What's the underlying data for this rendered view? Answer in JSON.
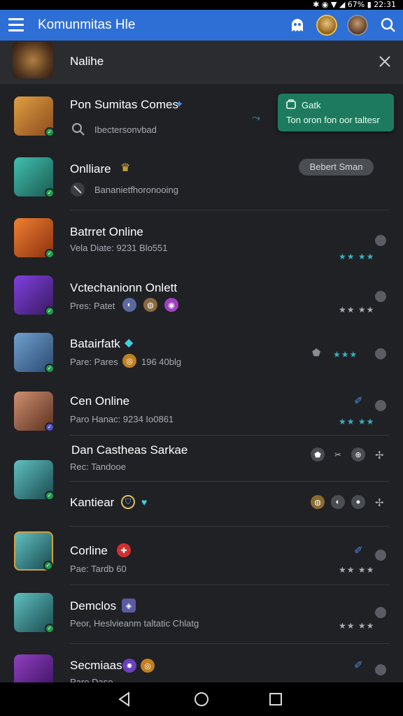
{
  "status": {
    "text": "✱ ◉ ▼ ◢ 67% ▮ 22:31"
  },
  "app": {
    "title": "Komunmitas Hle"
  },
  "icons": {
    "menu": "hamburger-menu-icon",
    "ghost": "ghost-icon",
    "search": "search-icon",
    "close": "close-icon",
    "back": "back-icon",
    "home": "home-icon",
    "recents": "recents-icon"
  },
  "banner": {
    "title": "Nalihe"
  },
  "toast": {
    "title": "Gatk",
    "text": "Ton oron fon oor taltesr"
  },
  "items": [
    {
      "name": "Pon Sumitas Comes",
      "sub": "Ibectersonvbad",
      "thumb": [
        "#e0a040",
        "#8a4a20"
      ]
    },
    {
      "name": "Onlliare",
      "sub": "Bananietfhoronooing",
      "pill": "Bebert Sman",
      "thumb": [
        "#40c0b0",
        "#1a5a50"
      ]
    },
    {
      "name": "Batrret Online",
      "sub": "Vela Diate: 9231 Blo551",
      "thumb": [
        "#f08030",
        "#8a3010"
      ]
    },
    {
      "name": "Vctechanionn Onlett",
      "sub": "Pres: Patet",
      "thumb": [
        "#8040e0",
        "#3a1a60"
      ]
    },
    {
      "name": "Batairfatk",
      "sub": "Pare: Pares",
      "sub_extra": "196 40blg",
      "thumb": [
        "#70a0d0",
        "#2a4a70"
      ]
    },
    {
      "name": "Cen Online",
      "sub": "Paro Hanac: 9234 Io0861",
      "thumb": [
        "#d09070",
        "#5a3020"
      ]
    },
    {
      "name": "Dan Castheas Sarkae",
      "sub": "Rec: Tandooe",
      "thumb": [
        "#60c0c0",
        "#1a4a50"
      ]
    },
    {
      "name": "Kantiear",
      "sub": "",
      "thumb": [
        "#60c0c0",
        "#1a4a50"
      ]
    },
    {
      "name": "Corline",
      "sub": "Pae: Tardb 60",
      "thumb": [
        "#9040c0",
        "#3a1060"
      ]
    },
    {
      "name": "Demclos",
      "sub": "Peor, Heslvieanm taltatic Chlatg",
      "thumb": [
        "#50b070",
        "#1a4a2a"
      ]
    },
    {
      "name": "Secmiaas",
      "sub": "Paro Daso",
      "thumb": [
        "#e0a050",
        "#7a4010"
      ]
    }
  ]
}
